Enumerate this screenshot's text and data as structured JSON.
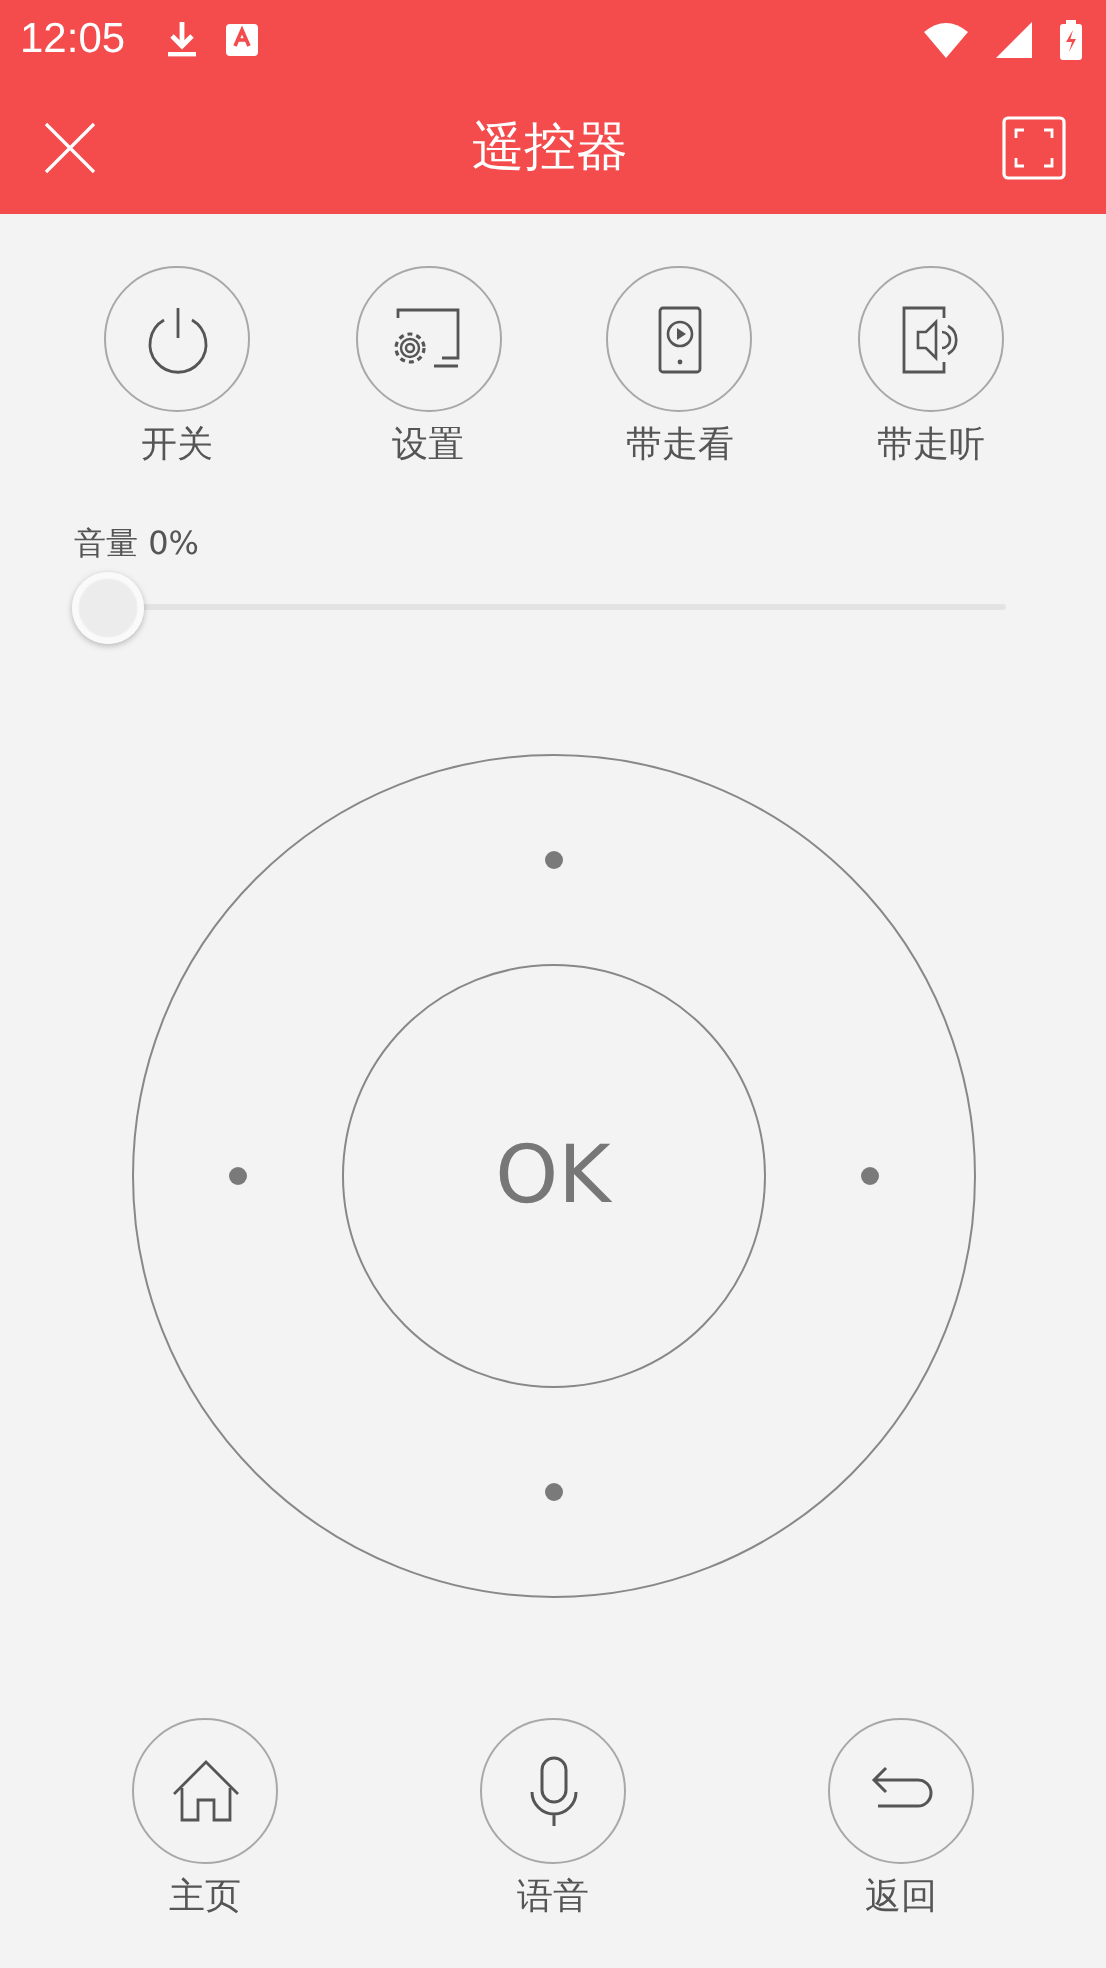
{
  "status_bar": {
    "time": "12:05"
  },
  "header": {
    "title": "遥控器"
  },
  "top_buttons": [
    {
      "kind": "power",
      "label": "开关"
    },
    {
      "kind": "settings",
      "label": "设置"
    },
    {
      "kind": "video",
      "label": "带走看"
    },
    {
      "kind": "audio",
      "label": "带走听"
    }
  ],
  "volume": {
    "label": "音量 0%",
    "level": 0
  },
  "dpad": {
    "ok": "OK"
  },
  "bottom_buttons": [
    {
      "kind": "home",
      "label": "主页"
    },
    {
      "kind": "voice",
      "label": "语音"
    },
    {
      "kind": "back",
      "label": "返回"
    }
  ]
}
